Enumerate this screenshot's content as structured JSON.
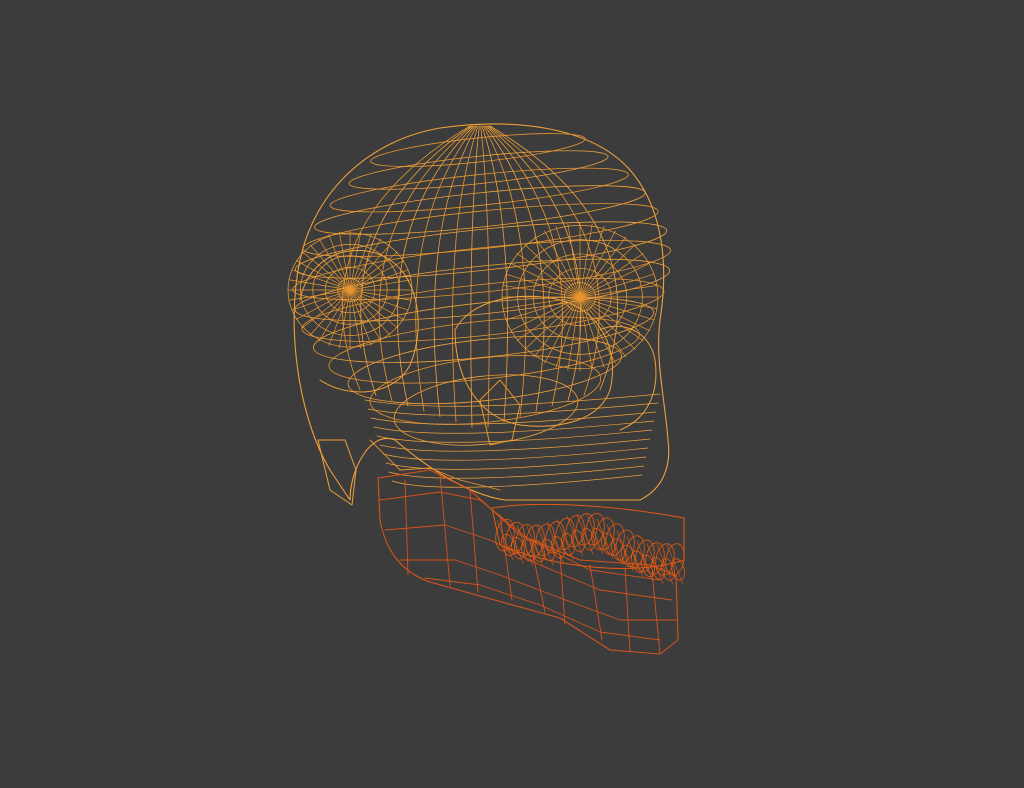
{
  "viewport": {
    "background_color": "#3c3c3c"
  },
  "model": {
    "render_mode": "wireframe",
    "cranium_color": "#f0a23a",
    "cranium_highlight_color": "#e8952e",
    "mandible_color": "#d6531c",
    "teeth_color": "#e35a12"
  }
}
